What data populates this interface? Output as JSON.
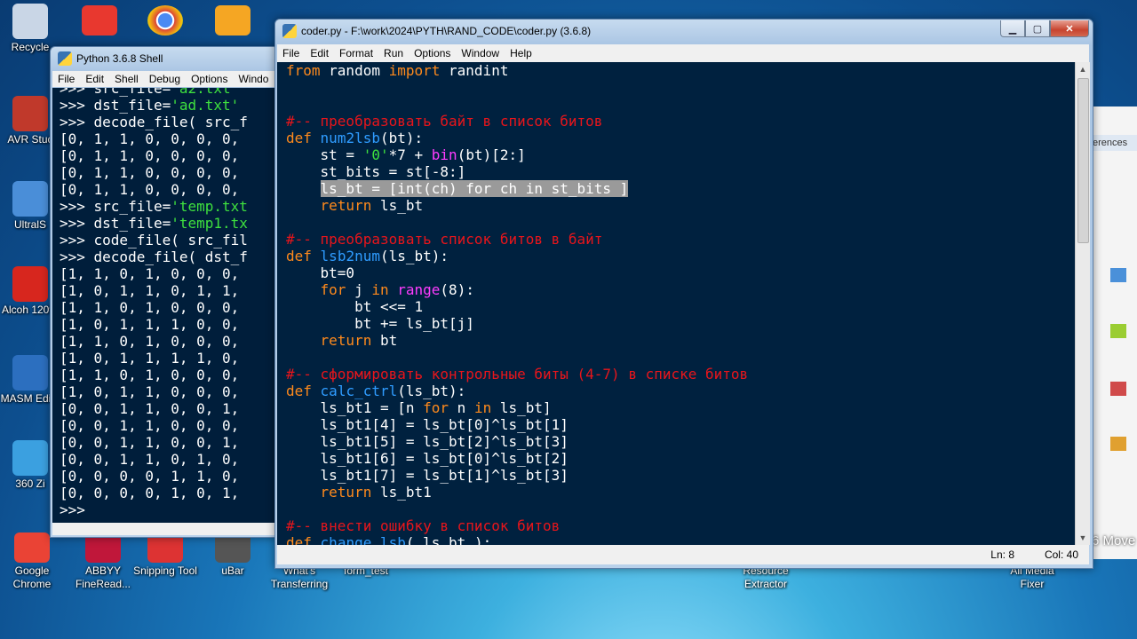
{
  "desktop": {
    "icons_left": [
      {
        "name": "recycle-bin-icon",
        "label": "Recycle"
      },
      {
        "name": "avr-studio-icon",
        "label": "AVR Stuc"
      },
      {
        "name": "ultraiso-icon",
        "label": "UltralS"
      },
      {
        "name": "alcohol-icon",
        "label": "Alcoh 120%"
      },
      {
        "name": "masm-editor-icon",
        "label": "MASM Edito"
      },
      {
        "name": "360-zip-icon",
        "label": "360 Zi"
      }
    ],
    "icons_bottom": [
      {
        "name": "google-chrome-icon",
        "label": "Google Chrome"
      },
      {
        "name": "abbyy-finereader-icon",
        "label": "ABBYY FineRead..."
      },
      {
        "name": "snipping-tool-icon",
        "label": "Snipping Tool"
      },
      {
        "name": "ubar-icon",
        "label": "uBar"
      },
      {
        "name": "whats-transferring-icon",
        "label": "What's Transferring"
      },
      {
        "name": "form-test-icon",
        "label": "form_test"
      },
      {
        "name": "resource-extractor-icon",
        "label": "Resource Extractor"
      },
      {
        "name": "all-media-fixer-icon",
        "label": "All Media Fixer"
      }
    ],
    "behind_window_text": {
      "tab": "erences",
      "bottom": "6 Move"
    }
  },
  "shell": {
    "title": "Python 3.6.8 Shell",
    "menu": [
      "File",
      "Edit",
      "Shell",
      "Debug",
      "Options",
      "Windo"
    ],
    "lines": [
      ">>> src_file='a2.txt'",
      ">>> dst_file='ad.txt'",
      ">>> decode_file( src_f",
      "[0, 1, 1, 0, 0, 0, 0,",
      "[0, 1, 1, 0, 0, 0, 0,",
      "[0, 1, 1, 0, 0, 0, 0,",
      "[0, 1, 1, 0, 0, 0, 0,",
      ">>> src_file='temp.txt",
      ">>> dst_file='temp1.tx",
      ">>> code_file( src_fil",
      ">>> decode_file( dst_f",
      "[1, 1, 0, 1, 0, 0, 0,",
      "[1, 0, 1, 1, 0, 1, 1,",
      "[1, 1, 0, 1, 0, 0, 0,",
      "[1, 0, 1, 1, 1, 0, 0,",
      "[1, 1, 0, 1, 0, 0, 0,",
      "[1, 0, 1, 1, 1, 1, 0,",
      "[1, 1, 0, 1, 0, 0, 0,",
      "[1, 0, 1, 1, 0, 0, 0,",
      "[0, 0, 1, 1, 0, 0, 1,",
      "[0, 0, 1, 1, 0, 0, 0,",
      "[0, 0, 1, 1, 0, 0, 1,",
      "[0, 0, 1, 1, 0, 1, 0,",
      "[0, 0, 0, 0, 1, 1, 0,",
      "[0, 0, 0, 0, 1, 0, 1,",
      ">>> "
    ]
  },
  "editor": {
    "title": "coder.py - F:\\work\\2024\\PYTH\\RAND_CODE\\coder.py (3.6.8)",
    "menu": [
      "File",
      "Edit",
      "Format",
      "Run",
      "Options",
      "Window",
      "Help"
    ],
    "status": {
      "line": "Ln: 8",
      "col": "Col: 40"
    },
    "code": [
      [
        [
          "kw",
          "from"
        ],
        [
          "t",
          " random "
        ],
        [
          "kw",
          "import"
        ],
        [
          "t",
          " randint"
        ]
      ],
      [],
      [],
      [
        [
          "cm",
          "#-- преобразовать байт в список битов"
        ]
      ],
      [
        [
          "kw",
          "def"
        ],
        [
          "t",
          " "
        ],
        [
          "fn",
          "num2lsb"
        ],
        [
          "t",
          "(bt):"
        ]
      ],
      [
        [
          "t",
          "    st = "
        ],
        [
          "str",
          "'0'"
        ],
        [
          "t",
          "*7 + "
        ],
        [
          "bi",
          "bin"
        ],
        [
          "t",
          "(bt)[2:]"
        ]
      ],
      [
        [
          "t",
          "    st_bits = st[-8:]"
        ]
      ],
      [
        [
          "t",
          "    "
        ],
        [
          "sel",
          "ls_bt = [int(ch) for ch in st_bits ]"
        ]
      ],
      [
        [
          "t",
          "    "
        ],
        [
          "kw",
          "return"
        ],
        [
          "t",
          " ls_bt"
        ]
      ],
      [],
      [
        [
          "cm",
          "#-- преобразовать список битов в байт"
        ]
      ],
      [
        [
          "kw",
          "def"
        ],
        [
          "t",
          " "
        ],
        [
          "fn",
          "lsb2num"
        ],
        [
          "t",
          "(ls_bt):"
        ]
      ],
      [
        [
          "t",
          "    bt=0"
        ]
      ],
      [
        [
          "t",
          "    "
        ],
        [
          "kw",
          "for"
        ],
        [
          "t",
          " j "
        ],
        [
          "kw",
          "in"
        ],
        [
          "t",
          " "
        ],
        [
          "bi",
          "range"
        ],
        [
          "t",
          "(8):"
        ]
      ],
      [
        [
          "t",
          "        bt <<= 1"
        ]
      ],
      [
        [
          "t",
          "        bt += ls_bt[j]"
        ]
      ],
      [
        [
          "t",
          "    "
        ],
        [
          "kw",
          "return"
        ],
        [
          "t",
          " bt"
        ]
      ],
      [],
      [
        [
          "cm",
          "#-- сформировать контрольные биты (4-7) в списке битов"
        ]
      ],
      [
        [
          "kw",
          "def"
        ],
        [
          "t",
          " "
        ],
        [
          "fn",
          "calc_ctrl"
        ],
        [
          "t",
          "(ls_bt):"
        ]
      ],
      [
        [
          "t",
          "    ls_bt1 = [n "
        ],
        [
          "kw",
          "for"
        ],
        [
          "t",
          " n "
        ],
        [
          "kw",
          "in"
        ],
        [
          "t",
          " ls_bt]"
        ]
      ],
      [
        [
          "t",
          "    ls_bt1[4] = ls_bt[0]^ls_bt[1]"
        ]
      ],
      [
        [
          "t",
          "    ls_bt1[5] = ls_bt[2]^ls_bt[3]"
        ]
      ],
      [
        [
          "t",
          "    ls_bt1[6] = ls_bt[0]^ls_bt[2]"
        ]
      ],
      [
        [
          "t",
          "    ls_bt1[7] = ls_bt[1]^ls_bt[3]"
        ]
      ],
      [
        [
          "t",
          "    "
        ],
        [
          "kw",
          "return"
        ],
        [
          "t",
          " ls_bt1"
        ]
      ],
      [],
      [
        [
          "cm",
          "#-- внести ошибку в список битов"
        ]
      ],
      [
        [
          "kw",
          "def"
        ],
        [
          "t",
          " "
        ],
        [
          "fn",
          "change_lsb"
        ],
        [
          "t",
          "( ls_bt ):"
        ]
      ]
    ]
  },
  "colors": {
    "editor_bg": "#00213f",
    "shell_bg": "#001e3b",
    "keyword": "#ff8a1c",
    "builtin": "#ff3cff",
    "string": "#3ee03e",
    "comment": "#e8151b",
    "def_name": "#2f9cff"
  }
}
